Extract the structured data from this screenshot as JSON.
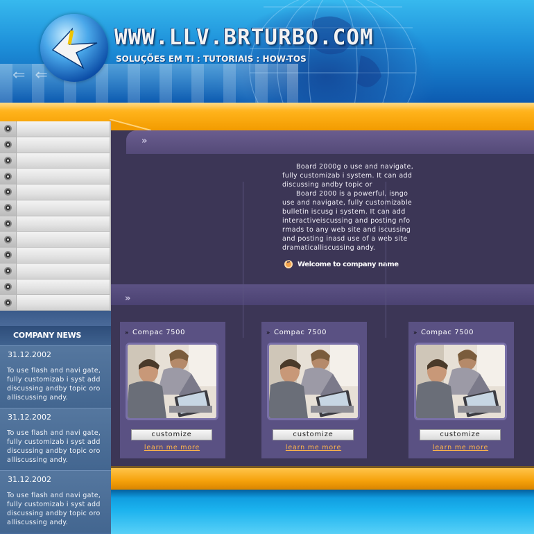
{
  "header": {
    "site_title": "WWW.LLV.BRTURBO.COM",
    "tagline": "SOLUÇÕES EM TI : TUTORIAIS : HOW-TOS"
  },
  "menu": {
    "items": [
      "",
      "",
      "",
      "",
      "",
      "",
      "",
      "",
      "",
      "",
      "",
      ""
    ]
  },
  "news": {
    "heading": "COMPANY NEWS",
    "items": [
      {
        "date": "31.12.2002",
        "text": "To use flash and navi gate, fully customizab i syst add discussing andby topic oro alliscussing andy."
      },
      {
        "date": "31.12.2002",
        "text": "To use flash and navi gate, fully customizab i syst add discussing andby topic oro alliscussing andy."
      },
      {
        "date": "31.12.2002",
        "text": "To use flash and navi gate, fully customizab i syst add discussing andby topic oro alliscussing andy."
      }
    ]
  },
  "intro": {
    "paragraph1": "Board 2000g o use and navigate, fully customizab i system. It can add discussing andby topic or",
    "paragraph2": "Board 2000 is a powerful, isngo use and navigate, fully customizable bulletin  iscusg i system. It can add interactiveiscussing and posting nfo rmads to any web site and iscussing and posting inasd use of a web site dramaticalliscussing andy.",
    "welcome_link": "Welcome to company name"
  },
  "products": [
    {
      "name": "Compac 7500",
      "button": "customize",
      "link": "learn me more"
    },
    {
      "name": "Compac 7500",
      "button": "customize",
      "link": "learn me more"
    },
    {
      "name": "Compac 7500",
      "button": "customize",
      "link": "learn me more"
    }
  ],
  "colors": {
    "accent_orange": "#f5a10a",
    "panel_purple": "#3c3656",
    "news_blue": "#476b9a",
    "link_orange": "#ffb54a"
  }
}
